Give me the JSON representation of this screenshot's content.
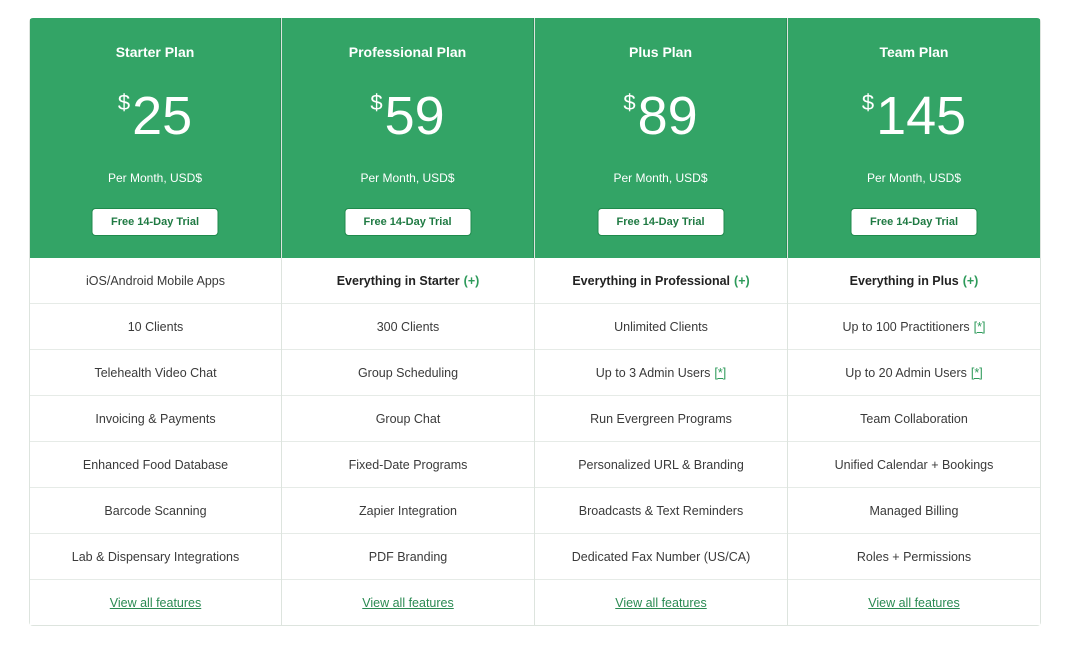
{
  "plans": [
    {
      "name": "Starter Plan",
      "currency": "$",
      "price": "25",
      "period": "Per Month, USD$",
      "cta": "Free 14-Day Trial",
      "features": [
        {
          "text": "iOS/Android Mobile Apps",
          "strong": false,
          "plus": "",
          "note": ""
        },
        {
          "text": "10 Clients",
          "strong": false,
          "plus": "",
          "note": ""
        },
        {
          "text": "Telehealth Video Chat",
          "strong": false,
          "plus": "",
          "note": ""
        },
        {
          "text": "Invoicing & Payments",
          "strong": false,
          "plus": "",
          "note": ""
        },
        {
          "text": "Enhanced Food Database",
          "strong": false,
          "plus": "",
          "note": ""
        },
        {
          "text": "Barcode Scanning",
          "strong": false,
          "plus": "",
          "note": ""
        },
        {
          "text": "Lab & Dispensary Integrations",
          "strong": false,
          "plus": "",
          "note": ""
        }
      ],
      "view_all": "View all features"
    },
    {
      "name": "Professional Plan",
      "currency": "$",
      "price": "59",
      "period": "Per Month, USD$",
      "cta": "Free 14-Day Trial",
      "features": [
        {
          "text": "Everything in Starter",
          "strong": true,
          "plus": "(+)",
          "note": ""
        },
        {
          "text": "300 Clients",
          "strong": false,
          "plus": "",
          "note": ""
        },
        {
          "text": "Group Scheduling",
          "strong": false,
          "plus": "",
          "note": ""
        },
        {
          "text": "Group Chat",
          "strong": false,
          "plus": "",
          "note": ""
        },
        {
          "text": "Fixed-Date Programs",
          "strong": false,
          "plus": "",
          "note": ""
        },
        {
          "text": "Zapier Integration",
          "strong": false,
          "plus": "",
          "note": ""
        },
        {
          "text": "PDF Branding",
          "strong": false,
          "plus": "",
          "note": ""
        }
      ],
      "view_all": "View all features"
    },
    {
      "name": "Plus Plan",
      "currency": "$",
      "price": "89",
      "period": "Per Month, USD$",
      "cta": "Free 14-Day Trial",
      "features": [
        {
          "text": "Everything in Professional",
          "strong": true,
          "plus": "(+)",
          "note": ""
        },
        {
          "text": "Unlimited Clients",
          "strong": false,
          "plus": "",
          "note": ""
        },
        {
          "text": "Up to 3 Admin Users",
          "strong": false,
          "plus": "",
          "note": "[*]"
        },
        {
          "text": "Run Evergreen Programs",
          "strong": false,
          "plus": "",
          "note": ""
        },
        {
          "text": "Personalized URL & Branding",
          "strong": false,
          "plus": "",
          "note": ""
        },
        {
          "text": "Broadcasts & Text Reminders",
          "strong": false,
          "plus": "",
          "note": ""
        },
        {
          "text": "Dedicated Fax Number (US/CA)",
          "strong": false,
          "plus": "",
          "note": ""
        }
      ],
      "view_all": "View all features"
    },
    {
      "name": "Team Plan",
      "currency": "$",
      "price": "145",
      "period": "Per Month, USD$",
      "cta": "Free 14-Day Trial",
      "features": [
        {
          "text": "Everything in Plus",
          "strong": true,
          "plus": "(+)",
          "note": ""
        },
        {
          "text": "Up to 100 Practitioners",
          "strong": false,
          "plus": "",
          "note": "[*]"
        },
        {
          "text": "Up to 20 Admin Users",
          "strong": false,
          "plus": "",
          "note": "[*]"
        },
        {
          "text": "Team Collaboration",
          "strong": false,
          "plus": "",
          "note": ""
        },
        {
          "text": "Unified Calendar + Bookings",
          "strong": false,
          "plus": "",
          "note": ""
        },
        {
          "text": "Managed Billing",
          "strong": false,
          "plus": "",
          "note": ""
        },
        {
          "text": "Roles + Permissions",
          "strong": false,
          "plus": "",
          "note": ""
        }
      ],
      "view_all": "View all features"
    }
  ],
  "colors": {
    "header_green": "#33a466",
    "accent_green": "#2d9a5a"
  }
}
